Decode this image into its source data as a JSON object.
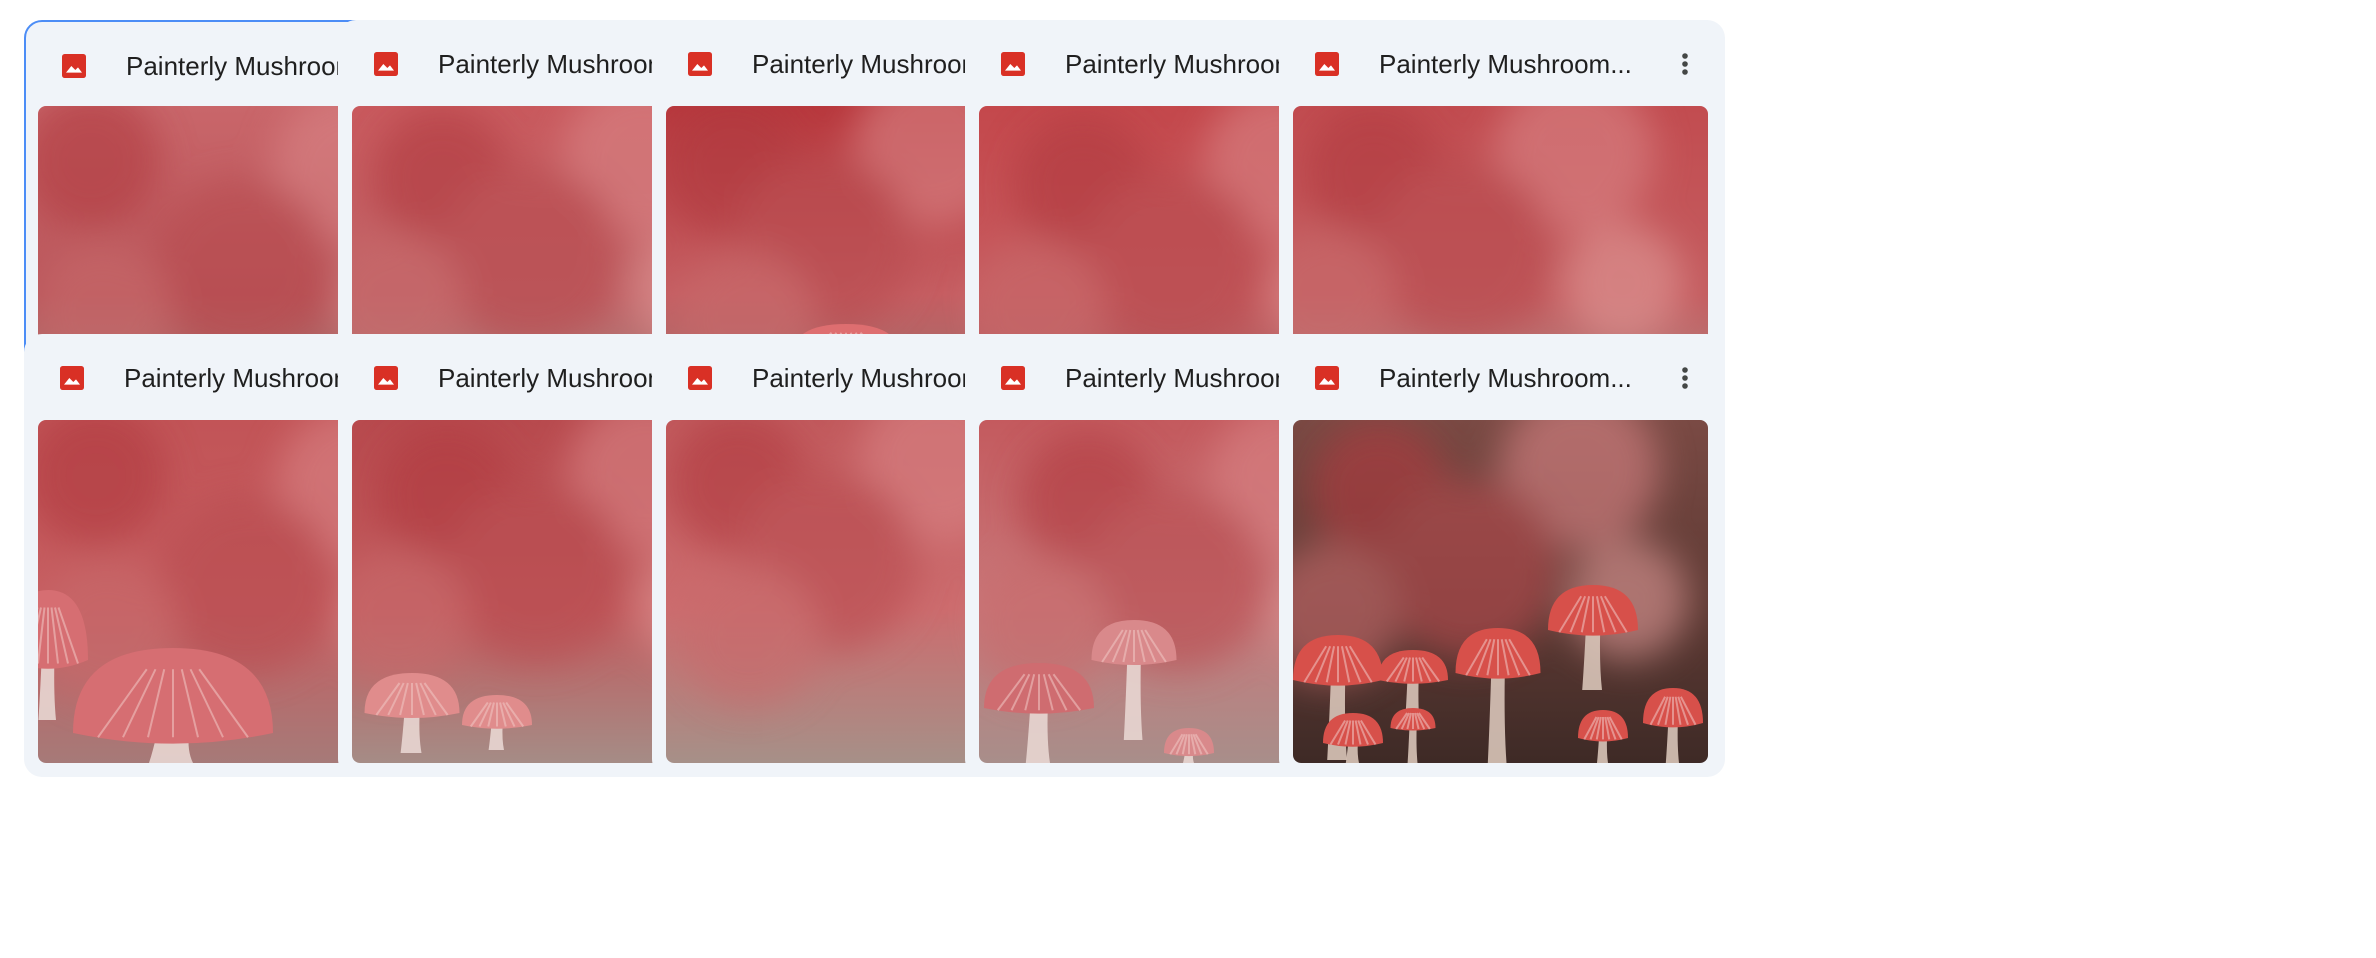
{
  "files": [
    {
      "title": "Painterly Mushroom...",
      "icon": "image-file-icon",
      "selected": true,
      "palette": {
        "top": "#c9666a",
        "mid": "#b9555a",
        "bottom": "#9c8a80"
      },
      "mushrooms": "none"
    },
    {
      "title": "Painterly Mushroom...",
      "icon": "image-file-icon",
      "selected": false,
      "palette": {
        "top": "#c95a5e",
        "mid": "#c06266",
        "bottom": "#a08e86"
      },
      "mushrooms": "two-pale"
    },
    {
      "title": "Painterly Mushroom...",
      "icon": "image-file-icon",
      "selected": false,
      "palette": {
        "top": "#b8383d",
        "mid": "#c55e62",
        "bottom": "#8c7670"
      },
      "mushrooms": "two-tall"
    },
    {
      "title": "Painterly Mushroom...",
      "icon": "image-file-icon",
      "selected": false,
      "palette": {
        "top": "#c4484c",
        "mid": "#c65a5e",
        "bottom": "#a06a6a"
      },
      "mushrooms": "cluster-left"
    },
    {
      "title": "Painterly Mushroom...",
      "icon": "image-file-icon",
      "selected": false,
      "palette": {
        "top": "#c24c50",
        "mid": "#c45d60",
        "bottom": "#a89590"
      },
      "mushrooms": "corner"
    },
    {
      "title": "Painterly Mushroom...",
      "icon": "image-file-icon",
      "selected": false,
      "palette": {
        "top": "#c25457",
        "mid": "#c65e61",
        "bottom": "#a67a78"
      },
      "mushrooms": "big-left"
    },
    {
      "title": "Painterly Mushroom...",
      "icon": "image-file-icon",
      "selected": false,
      "palette": {
        "top": "#b84a4e",
        "mid": "#c25a5d",
        "bottom": "#a58c86"
      },
      "mushrooms": "small-left"
    },
    {
      "title": "Painterly Mushroom...",
      "icon": "image-file-icon",
      "selected": false,
      "palette": {
        "top": "#c25a5d",
        "mid": "#cc6c6e",
        "bottom": "#a69088"
      },
      "mushrooms": "none"
    },
    {
      "title": "Painterly Mushroom...",
      "icon": "image-file-icon",
      "selected": false,
      "palette": {
        "top": "#c45a5e",
        "mid": "#c8787a",
        "bottom": "#a88e8a"
      },
      "mushrooms": "misty-group"
    },
    {
      "title": "Painterly Mushroom...",
      "icon": "image-file-icon",
      "selected": false,
      "palette": {
        "top": "#7a4a44",
        "mid": "#5e3a34",
        "bottom": "#3e2a26"
      },
      "mushrooms": "dark-red-group"
    }
  ],
  "colors": {
    "card_bg": "#f0f4f9",
    "selected_border": "#4c8df6",
    "icon_red": "#d93025",
    "title_text": "#1f1f1f",
    "menu_icon": "#444746"
  },
  "more_menu_icon": "more-vert-icon"
}
